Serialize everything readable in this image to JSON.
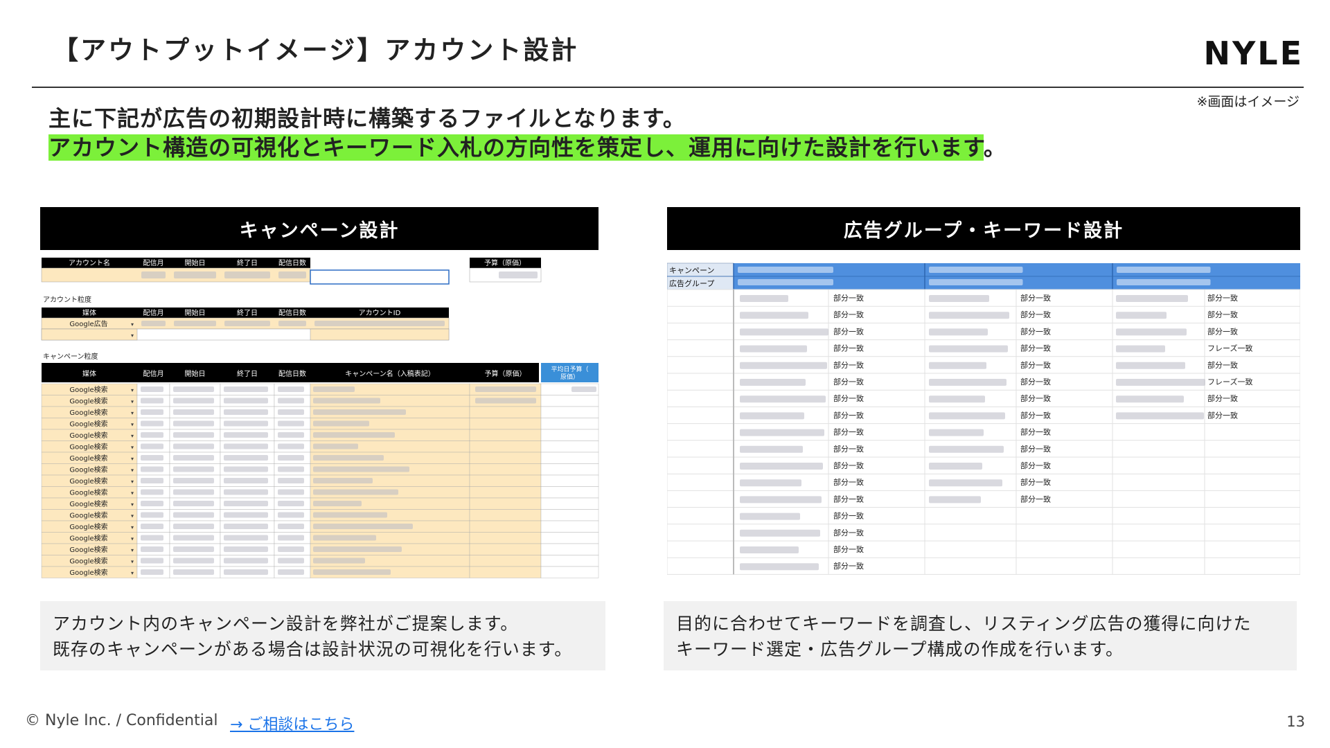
{
  "header": {
    "title": "【アウトプットイメージ】アカウント設計",
    "logo": "NYLE",
    "image_note": "※画面はイメージ"
  },
  "lead": {
    "line1": "主に下記が広告の初期設計時に構築するファイルとなります。",
    "line2_highlight": "アカウント構造の可視化とキーワード入札の方向性を策定し、運用に向けた設計を行います",
    "line2_tail": "。"
  },
  "left_panel": {
    "title": "キャンペーン設計",
    "sheet": {
      "account_headers": [
        "アカウント名",
        "配信月",
        "開始日",
        "終了日",
        "配信日数"
      ],
      "budget_header": "予算（原価）",
      "account_granularity_label": "アカウント粒度",
      "account_table_headers": [
        "媒体",
        "配信月",
        "開始日",
        "終了日",
        "配信日数",
        "アカウントID"
      ],
      "account_media": "Google広告",
      "campaign_granularity_label": "キャンペーン粒度",
      "campaign_table_headers": [
        "媒体",
        "配信月",
        "開始日",
        "終了日",
        "配信日数",
        "キャンペーン名（入稿表記）",
        "予算（原価）",
        "平均日予算（原価）"
      ],
      "campaign_media": [
        "Google検索",
        "Google検索",
        "Google検索",
        "Google検索",
        "Google検索",
        "Google検索",
        "Google検索",
        "Google検索",
        "Google検索",
        "Google検索",
        "Google検索",
        "Google検索",
        "Google検索",
        "Google検索",
        "Google検索",
        "Google検索",
        "Google検索"
      ]
    },
    "description_line1": "アカウント内のキャンペーン設計を弊社がご提案します。",
    "description_line2": "既存のキャンペーンがある場合は設計状況の可視化を行います。"
  },
  "right_panel": {
    "title": "広告グループ・キーワード設計",
    "sheet": {
      "row_labels": [
        "キャンペーン",
        "広告グループ"
      ],
      "col1_match": [
        "部分一致",
        "部分一致",
        "部分一致",
        "部分一致",
        "部分一致",
        "部分一致",
        "部分一致",
        "部分一致",
        "部分一致",
        "部分一致",
        "部分一致",
        "部分一致",
        "部分一致",
        "部分一致",
        "部分一致",
        "部分一致",
        "部分一致"
      ],
      "col2_match": [
        "部分一致",
        "部分一致",
        "部分一致",
        "部分一致",
        "部分一致",
        "部分一致",
        "部分一致",
        "部分一致",
        "部分一致",
        "部分一致",
        "部分一致",
        "部分一致",
        "部分一致"
      ],
      "col3_match": [
        "部分一致",
        "部分一致",
        "部分一致",
        "フレーズ一致",
        "部分一致",
        "フレーズ一致",
        "部分一致",
        "部分一致"
      ]
    },
    "description_line1": "目的に合わせてキーワードを調査し、リスティング広告の獲得に向けた",
    "description_line2": "キーワード選定・広告グループ構成の作成を行います。"
  },
  "footer": {
    "copyright": "© Nyle Inc. / Confidential",
    "link": "→ ご相談はこちら",
    "page_number": "13"
  }
}
